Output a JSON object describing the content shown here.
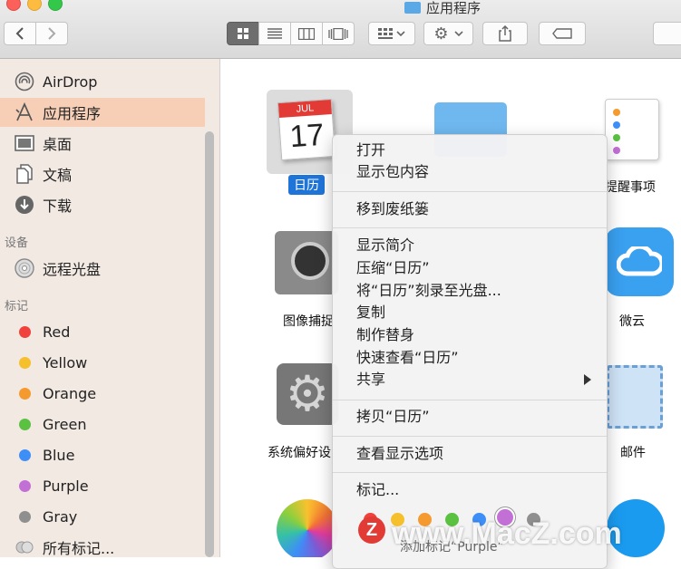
{
  "window": {
    "title": "应用程序"
  },
  "colors": {
    "close": "#fc605b",
    "minimize": "#fdbc40",
    "zoom": "#34c84a",
    "selection": "#1f74d8",
    "sidebar_selected": "#f7cfb7"
  },
  "toolbar": {
    "back_icon": "chevron-left-icon",
    "forward_icon": "chevron-right-icon",
    "views": [
      "icon-view-icon",
      "list-view-icon",
      "column-view-icon",
      "coverflow-view-icon"
    ],
    "arrange_icon": "arrange-grid-icon",
    "action_icon": "gear-icon",
    "share_icon": "share-icon",
    "tag_icon": "tag-icon"
  },
  "sidebar": {
    "favorites": [
      {
        "label": "AirDrop",
        "icon": "airdrop-icon"
      },
      {
        "label": "应用程序",
        "icon": "applications-icon",
        "selected": true
      },
      {
        "label": "桌面",
        "icon": "desktop-icon"
      },
      {
        "label": "文稿",
        "icon": "documents-icon"
      },
      {
        "label": "下载",
        "icon": "downloads-icon"
      }
    ],
    "devices_header": "设备",
    "devices": [
      {
        "label": "远程光盘",
        "icon": "disc-icon"
      }
    ],
    "tags_header": "标记",
    "tags": [
      {
        "label": "Red",
        "color": "#f0413c"
      },
      {
        "label": "Yellow",
        "color": "#f5c02b"
      },
      {
        "label": "Orange",
        "color": "#f59a2e"
      },
      {
        "label": "Green",
        "color": "#5ac141"
      },
      {
        "label": "Blue",
        "color": "#3e8ef7"
      },
      {
        "label": "Purple",
        "color": "#c26fd6"
      },
      {
        "label": "Gray",
        "color": "#8f8f8f"
      }
    ],
    "all_tags": "所有标记..."
  },
  "apps": {
    "calendar": {
      "label": "日历",
      "month": "JUL",
      "day": "17"
    },
    "reminders": "提醒事项",
    "image_capture": "图像捕捉",
    "weiyun": "微云",
    "system_prefs": "系统偏好设",
    "mail": "邮件"
  },
  "context_menu": {
    "open": "打开",
    "show_package": "显示包内容",
    "move_to_trash": "移到废纸篓",
    "get_info": "显示简介",
    "compress": "压缩“日历”",
    "burn": "将“日历”刻录至光盘...",
    "duplicate": "复制",
    "make_alias": "制作替身",
    "quick_look": "快速查看“日历”",
    "share": "共享",
    "copy": "拷贝“日历”",
    "view_options": "查看显示选项",
    "tags": "标记...",
    "tag_colors": [
      "#f0413c",
      "#f5c02b",
      "#f59a2e",
      "#5ac141",
      "#3e8ef7",
      "#c26fd6",
      "#8f8f8f"
    ],
    "add_tag": "添加标记“Purple”"
  },
  "watermark": "www.MacZ.com"
}
